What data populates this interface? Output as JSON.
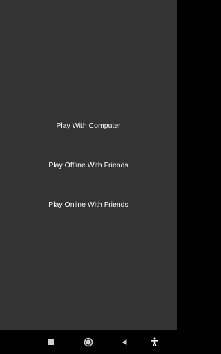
{
  "menu": {
    "play_computer_label": "Play With Computer",
    "play_offline_label": "Play Offline With Friends",
    "play_online_label": "Play Online With Friends"
  },
  "navbar": {
    "recents_icon": "square-recents-icon",
    "home_icon": "circle-home-icon",
    "back_icon": "triangle-back-icon",
    "accessibility_icon": "accessibility-person-icon"
  },
  "colors": {
    "background": "#333333",
    "text": "#ffffff",
    "navbar": "#000000"
  }
}
